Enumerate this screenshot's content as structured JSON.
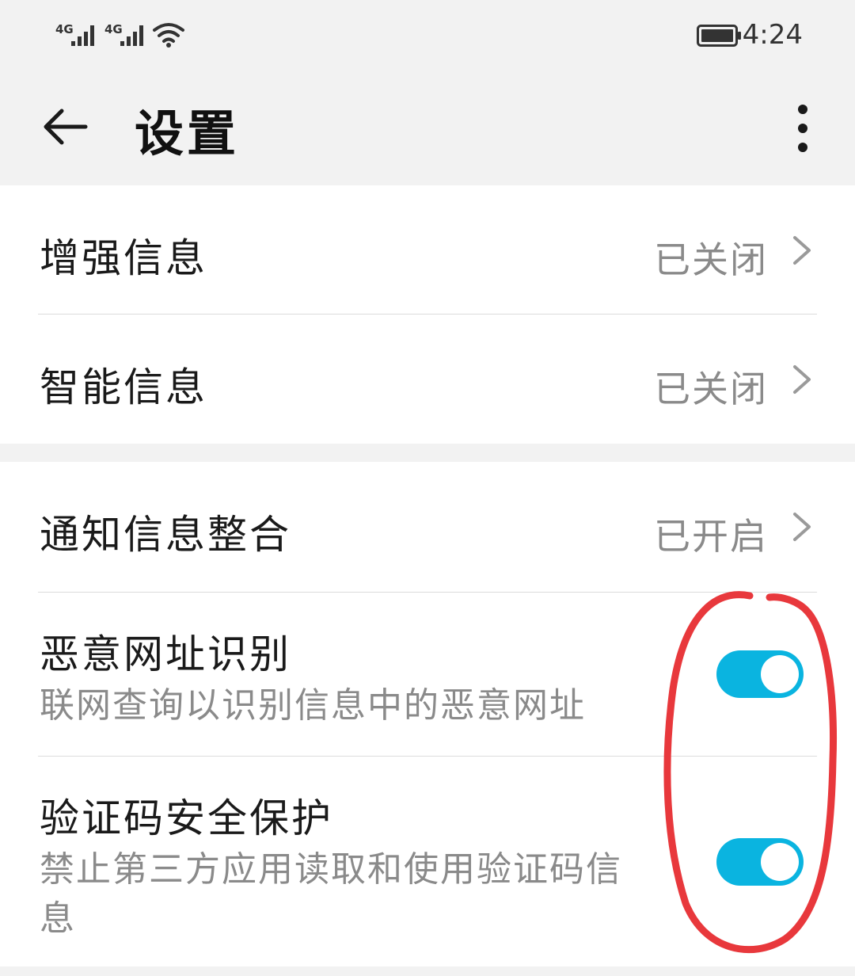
{
  "status_bar": {
    "sim1_label": "4G",
    "sim2_label": "4G",
    "time": "4:24",
    "icons": [
      "signal-icon",
      "signal-icon",
      "wifi-icon",
      "battery-icon"
    ]
  },
  "header": {
    "title": "设置",
    "back_icon": "arrow-left-icon",
    "more_icon": "more-vertical-icon"
  },
  "group1": [
    {
      "title": "增强信息",
      "value": "已关闭"
    },
    {
      "title": "智能信息",
      "value": "已关闭"
    }
  ],
  "group2": {
    "notify": {
      "title": "通知信息整合",
      "value": "已开启"
    },
    "malicious_url": {
      "title": "恶意网址识别",
      "subtitle": "联网查询以识别信息中的恶意网址",
      "enabled": true
    },
    "code_protect": {
      "title": "验证码安全保护",
      "subtitle": "禁止第三方应用读取和使用验证码信息",
      "enabled": true
    }
  },
  "colors": {
    "toggle_on": "#0ab4e0",
    "annotation": "#e8383c",
    "background": "#f2f2f2"
  }
}
